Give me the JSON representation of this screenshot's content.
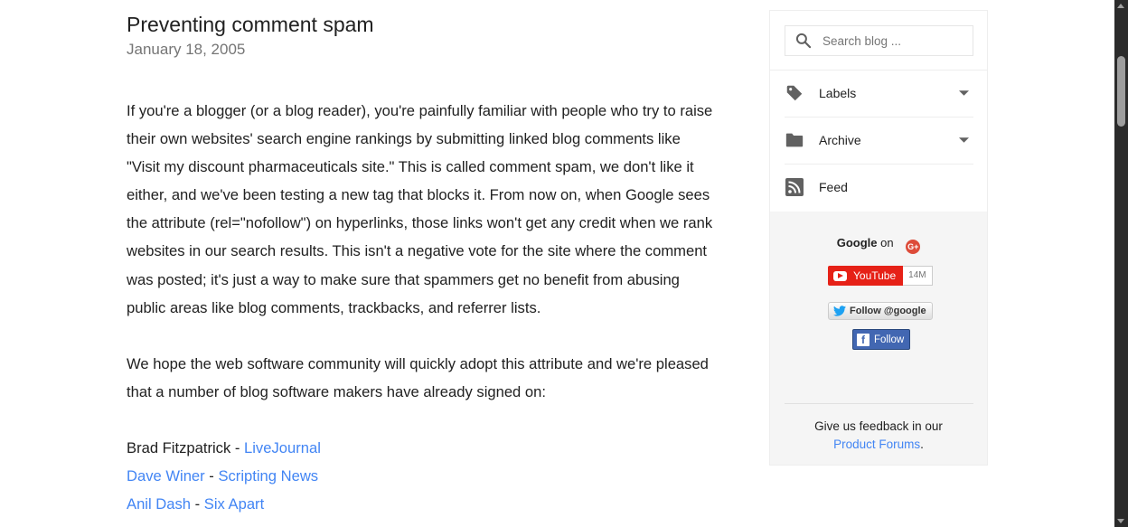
{
  "post": {
    "title": "Preventing comment spam",
    "date": "January 18, 2005",
    "paragraph1": "If you're a blogger (or a blog reader), you're painfully familiar with people who try to raise their own websites' search engine rankings by submitting linked blog comments like \"Visit my discount pharmaceuticals site.\" This is called comment spam, we don't like it either, and we've been testing a new tag that blocks it. From now on, when Google sees the attribute (rel=\"nofollow\") on hyperlinks, those links won't get any credit when we rank websites in our search results. This isn't a negative vote for the site where the comment was posted; it's just a way to make sure that spammers get no benefit from abusing public areas like blog comments, trackbacks, and referrer lists.",
    "paragraph2": "We hope the web software community will quickly adopt this attribute and we're pleased that a number of blog software makers have already signed on:",
    "signers": [
      {
        "name": "Brad Fitzpatrick",
        "name_is_link": false,
        "separator": " - ",
        "org": "LiveJournal"
      },
      {
        "name": "Dave Winer",
        "name_is_link": true,
        "separator": " - ",
        "org": "Scripting News"
      },
      {
        "name": "Anil Dash",
        "name_is_link": true,
        "separator": " - ",
        "org": "Six Apart"
      }
    ]
  },
  "sidebar": {
    "search_placeholder": "Search blog ...",
    "items": [
      {
        "label": "Labels",
        "icon": "tag-icon",
        "has_dropdown": true
      },
      {
        "label": "Archive",
        "icon": "folder-icon",
        "has_dropdown": true
      },
      {
        "label": "Feed",
        "icon": "rss-icon",
        "has_dropdown": false
      }
    ],
    "social": {
      "google_brand": "Google",
      "on_text": "on",
      "gplus_glyph": "G+",
      "youtube_label": "YouTube",
      "youtube_count": "14M",
      "twitter_label": "Follow @google",
      "facebook_glyph": "f",
      "facebook_label": "Follow"
    },
    "feedback_text": "Give us feedback in our",
    "feedback_link": "Product Forums",
    "feedback_end": "."
  },
  "colors": {
    "link": "#4285f4",
    "youtube": "#e62117",
    "facebook": "#4267b2",
    "gplus": "#dd4b39",
    "twitter": "#1da1f2"
  }
}
